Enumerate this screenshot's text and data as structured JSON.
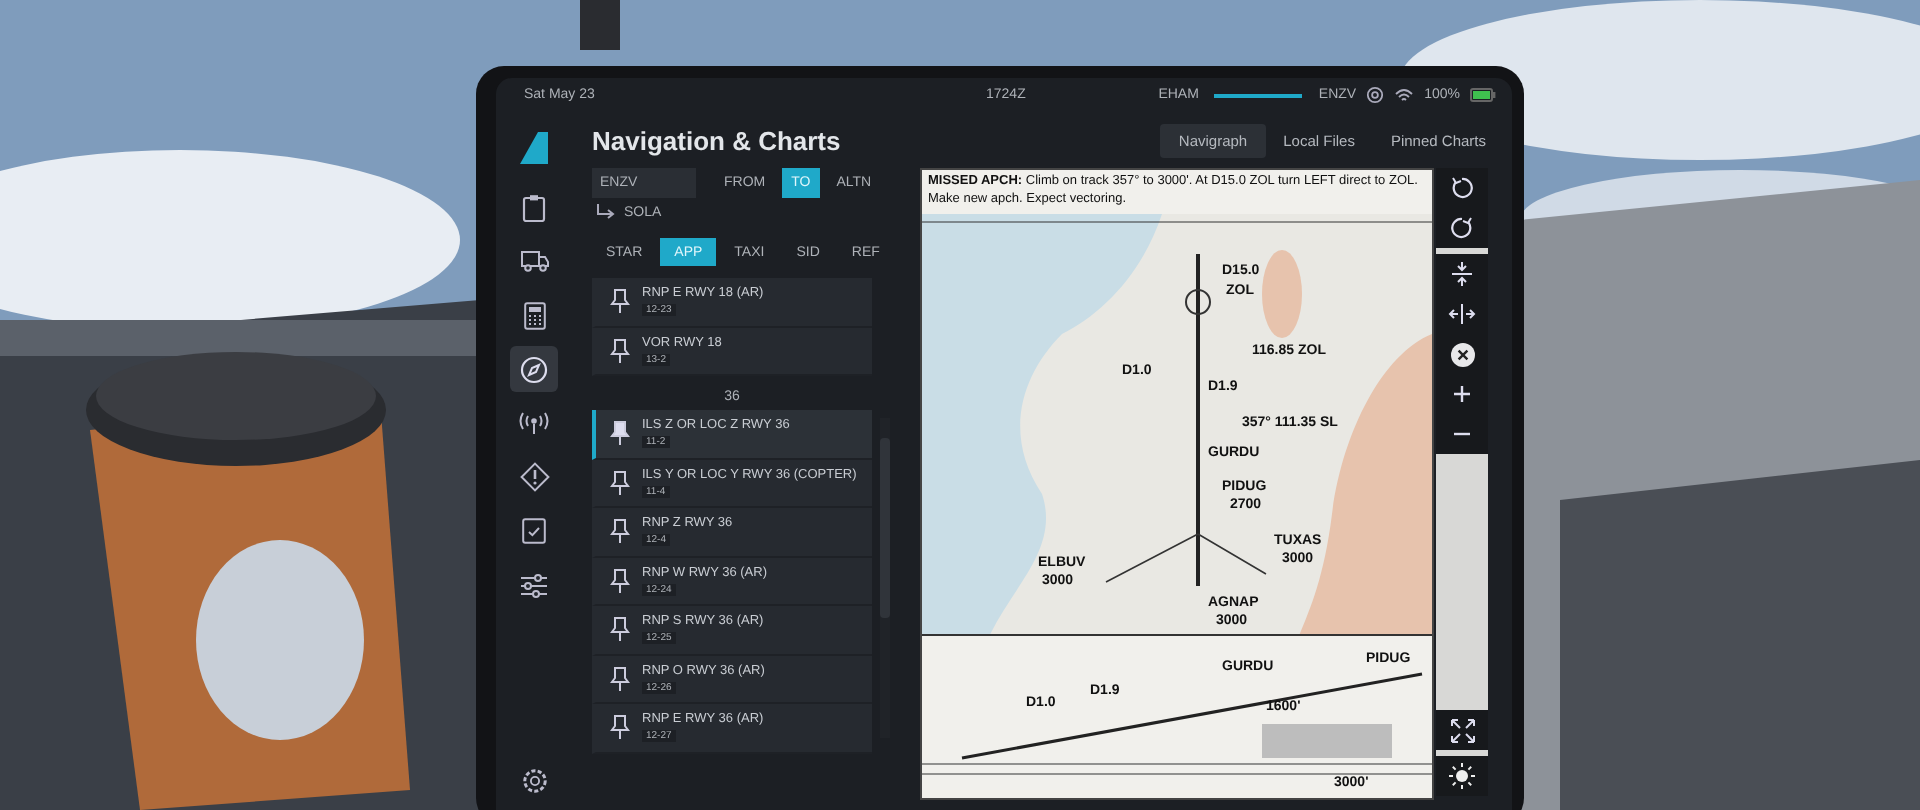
{
  "status_bar": {
    "date": "Sat May 23",
    "time": "1724Z",
    "origin": "EHAM",
    "destination": "ENZV",
    "battery": "100%"
  },
  "app": {
    "title": "Navigation & Charts"
  },
  "source_tabs": [
    {
      "label": "Navigraph",
      "selected": true
    },
    {
      "label": "Local Files",
      "selected": false
    },
    {
      "label": "Pinned Charts",
      "selected": false
    }
  ],
  "sidebar": {
    "items": [
      {
        "selected": false
      },
      {
        "selected": false
      },
      {
        "selected": false
      },
      {
        "selected": true
      },
      {
        "selected": false
      },
      {
        "selected": false
      },
      {
        "selected": false
      },
      {
        "selected": false
      }
    ]
  },
  "airport": {
    "value": "ENZV"
  },
  "role_tabs": [
    {
      "label": "FROM",
      "selected": false
    },
    {
      "label": "TO",
      "selected": true
    },
    {
      "label": "ALTN",
      "selected": false
    }
  ],
  "transition": "SOLA",
  "category_tabs": [
    {
      "label": "STAR",
      "selected": false
    },
    {
      "label": "APP",
      "selected": true
    },
    {
      "label": "TAXI",
      "selected": false
    },
    {
      "label": "SID",
      "selected": false
    },
    {
      "label": "REF",
      "selected": false
    }
  ],
  "chart_groups": [
    {
      "items": [
        {
          "name": "RNP E RWY 18 (AR)",
          "code": "12-23",
          "selected": false,
          "pinned": false
        },
        {
          "name": "VOR RWY 18",
          "code": "13-2",
          "selected": false,
          "pinned": false
        }
      ]
    },
    {
      "heading": "36",
      "items": [
        {
          "name": "ILS Z OR LOC Z RWY 36",
          "code": "11-2",
          "selected": true,
          "pinned": true
        },
        {
          "name": "ILS Y OR LOC Y RWY 36 (COPTER)",
          "code": "11-4",
          "selected": false,
          "pinned": false
        },
        {
          "name": "RNP Z RWY 36",
          "code": "12-4",
          "selected": false,
          "pinned": false
        },
        {
          "name": "RNP W RWY 36 (AR)",
          "code": "12-24",
          "selected": false,
          "pinned": false
        },
        {
          "name": "RNP S RWY 36 (AR)",
          "code": "12-25",
          "selected": false,
          "pinned": false
        },
        {
          "name": "RNP O RWY 36 (AR)",
          "code": "12-26",
          "selected": false,
          "pinned": false
        },
        {
          "name": "RNP E RWY 36 (AR)",
          "code": "12-27",
          "selected": false,
          "pinned": false
        }
      ]
    }
  ],
  "chart": {
    "missed_approach": "**MISSED APCH:** Climb on track 357° to 3000'. At D15.0 ZOL turn LEFT direct to ZOL. Make new apch. Expect vectoring.",
    "plan_labels": [
      "D15.0",
      "ZOL",
      "116.85 ZOL",
      "D1.0",
      "D1.9",
      "357° 111.35 SL",
      "GURDU",
      "PIDUG",
      "2700",
      "ELBUV",
      "3000",
      "TUXAS",
      "3000",
      "AGNAP",
      "3000"
    ],
    "profile_labels": [
      "GURDU",
      "PIDUG",
      "D1.0",
      "D1.9",
      "1600'",
      "3000'"
    ]
  }
}
